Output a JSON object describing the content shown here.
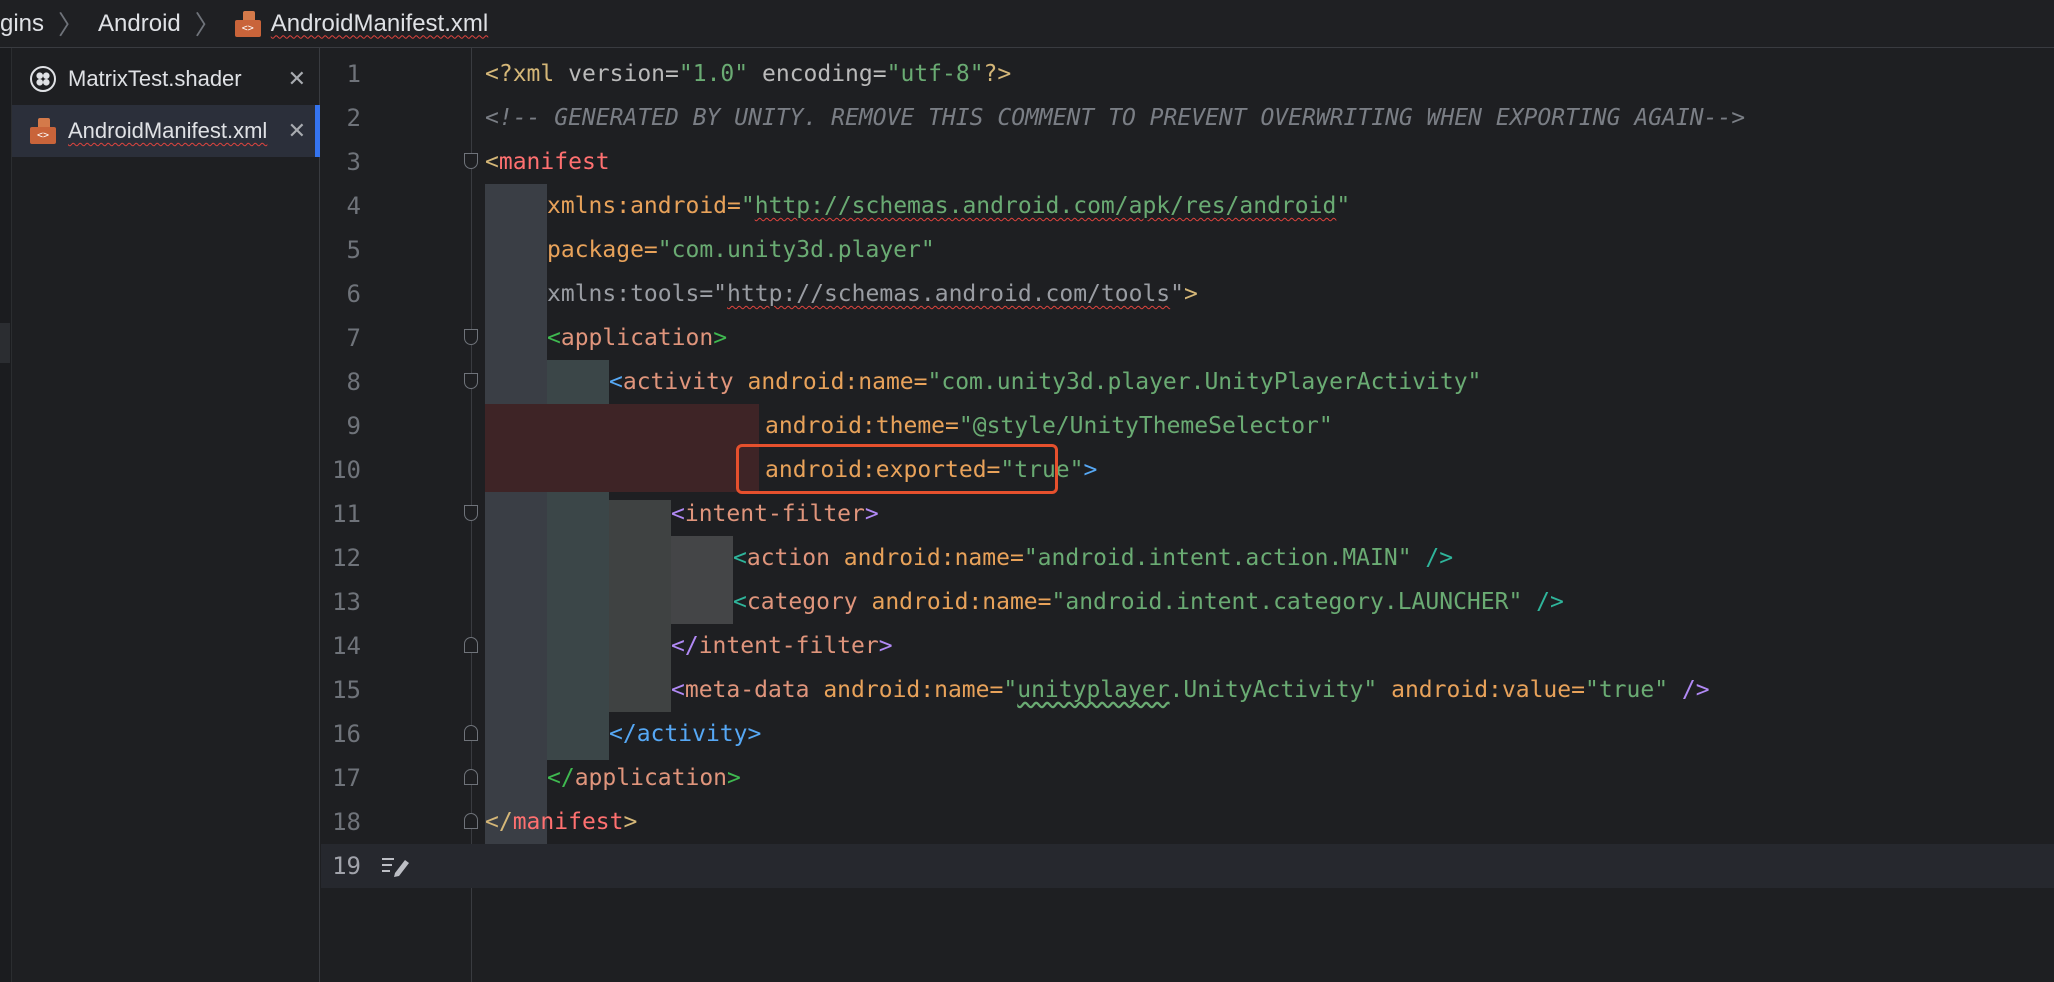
{
  "breadcrumb": {
    "items": [
      "gins",
      "Android",
      "AndroidManifest.xml"
    ]
  },
  "tabs": [
    {
      "label": "MatrixTest.shader",
      "icon": "shader-icon",
      "active": false
    },
    {
      "label": "AndroidManifest.xml",
      "icon": "xml-file-icon",
      "active": true
    }
  ],
  "editor": {
    "current_line": 19,
    "lines": [
      {
        "n": "1"
      },
      {
        "n": "2"
      },
      {
        "n": "3"
      },
      {
        "n": "4"
      },
      {
        "n": "5"
      },
      {
        "n": "6"
      },
      {
        "n": "7"
      },
      {
        "n": "8"
      },
      {
        "n": "9"
      },
      {
        "n": "10"
      },
      {
        "n": "11"
      },
      {
        "n": "12"
      },
      {
        "n": "13"
      },
      {
        "n": "14"
      },
      {
        "n": "15"
      },
      {
        "n": "16"
      },
      {
        "n": "17"
      },
      {
        "n": "18"
      },
      {
        "n": "19"
      }
    ],
    "code": {
      "l1": {
        "a": "<?xml",
        "b": " version=",
        "c": "\"1.0\"",
        "d": " encoding=",
        "e": "\"utf-8\"",
        "f": "?>"
      },
      "l2": {
        "a": "<!-- GENERATED BY UNITY. REMOVE THIS COMMENT TO PREVENT OVERWRITING WHEN EXPORTING AGAIN-->"
      },
      "l3": {
        "a": "<",
        "b": "manifest"
      },
      "l4": {
        "a": "xmlns:android=",
        "b": "\"",
        "c": "http://schemas.android.com/apk/res/android",
        "d": "\""
      },
      "l5": {
        "a": "package=",
        "b": "\"com.unity3d.player\""
      },
      "l6": {
        "a": "xmlns:tools=",
        "b": "\"",
        "c": "http://schemas.android.com/tools",
        "d": "\"",
        "e": ">"
      },
      "l7": {
        "a": "<",
        "b": "application",
        "c": ">"
      },
      "l8": {
        "a": "<",
        "b": "activity",
        "c": " android:name=",
        "d": "\"com.unity3d.player.UnityPlayerActivity\""
      },
      "l9": {
        "a": "android:theme=",
        "b": "\"@style/UnityThemeSelector\""
      },
      "l10": {
        "a": "android:exported=",
        "b": "\"true\"",
        "c": ">"
      },
      "l11": {
        "a": "<",
        "b": "intent-filter",
        "c": ">"
      },
      "l12": {
        "a": "<",
        "b": "action",
        "c": " android:name=",
        "d": "\"android.intent.action.MAIN\"",
        "e": " />"
      },
      "l13": {
        "a": "<",
        "b": "category",
        "c": " android:name=",
        "d": "\"android.intent.category.LAUNCHER\"",
        "e": " />"
      },
      "l14": {
        "a": "</",
        "b": "intent-filter",
        "c": ">"
      },
      "l15": {
        "a": "<",
        "b": "meta-data",
        "c": " android:name=",
        "d": "\"",
        "e": "unityplayer",
        "f": ".UnityActivity\"",
        "g": " android:value=",
        "h": "\"true\"",
        "i": " />"
      },
      "l16": {
        "a": "</",
        "b": "activity",
        "c": ">"
      },
      "l17": {
        "a": "</",
        "b": "application",
        "c": ">"
      },
      "l18": {
        "a": "</",
        "b": "manifest",
        "c": ">"
      }
    }
  },
  "colors": {
    "accent": "#3574f0",
    "highlight_box": "#e5502d",
    "background": "#1e1f22"
  }
}
